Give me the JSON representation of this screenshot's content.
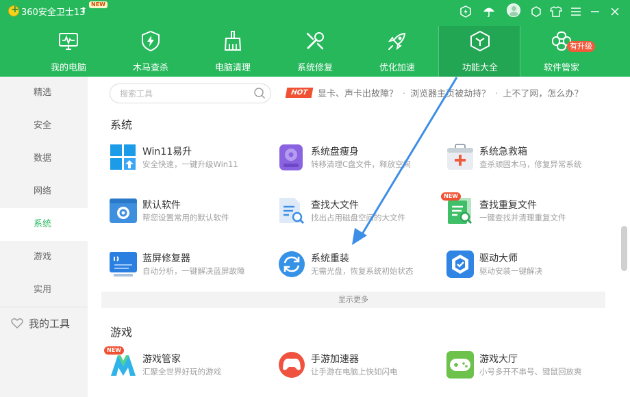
{
  "app": {
    "title": "360安全卫士13",
    "new_tag": "NEW"
  },
  "titlebar_icons": [
    "shield-badge-icon",
    "umbrella-icon",
    "avatar",
    "skin-icon",
    "shirt-icon",
    "menu-icon",
    "minimize-icon",
    "close-icon"
  ],
  "nav": [
    {
      "label": "我的电脑",
      "icon": "monitor-icon"
    },
    {
      "label": "木马查杀",
      "icon": "shield-bolt-icon"
    },
    {
      "label": "电脑清理",
      "icon": "broom-icon"
    },
    {
      "label": "系统修复",
      "icon": "wrench-icon"
    },
    {
      "label": "优化加速",
      "icon": "rocket-icon"
    },
    {
      "label": "功能大全",
      "icon": "cube-icon",
      "active": true
    },
    {
      "label": "软件管家",
      "icon": "flower-icon",
      "badge": "有升级"
    }
  ],
  "sidebar": {
    "items": [
      {
        "label": "精选"
      },
      {
        "label": "安全"
      },
      {
        "label": "数据"
      },
      {
        "label": "网络"
      },
      {
        "label": "系统",
        "active": true
      },
      {
        "label": "游戏"
      },
      {
        "label": "实用"
      }
    ],
    "my_tools": "我的工具"
  },
  "search": {
    "placeholder": "搜索工具",
    "value": ""
  },
  "hot": {
    "tag": "HOT",
    "links": [
      "显卡、声卡出故障？",
      "浏览器主页被劫持？",
      "上不了网，怎么办？"
    ],
    "separator": "·"
  },
  "sections": {
    "system": {
      "title": "系统",
      "tools": [
        {
          "name": "Win11易升",
          "desc": "安全快速，一键升级Win11",
          "icon": "windows-icon"
        },
        {
          "name": "系统盘瘦身",
          "desc": "转移清理C盘文件，释放空间",
          "icon": "disk-icon"
        },
        {
          "name": "系统急救箱",
          "desc": "查杀顽固木马，修复异常系统",
          "icon": "first-aid-icon"
        },
        {
          "name": "默认软件",
          "desc": "帮您设置常用的默认软件",
          "icon": "gear-window-icon"
        },
        {
          "name": "查找大文件",
          "desc": "找出占用磁盘空间的大文件",
          "icon": "find-file-icon"
        },
        {
          "name": "查找重复文件",
          "desc": "一键查找并清理重复文件",
          "icon": "duplicate-file-icon",
          "badge": "NEW"
        },
        {
          "name": "蓝屏修复器",
          "desc": "自动分析，一键解决蓝屏故障",
          "icon": "bluescreen-icon"
        },
        {
          "name": "系统重装",
          "desc": "无需光盘，恢复系统初始状态",
          "icon": "reinstall-icon"
        },
        {
          "name": "驱动大师",
          "desc": "驱动安装一键解决",
          "icon": "driver-icon"
        }
      ],
      "show_more": "显示更多"
    },
    "games": {
      "title": "游戏",
      "tools": [
        {
          "name": "游戏管家",
          "desc": "汇聚全世界好玩的游戏",
          "icon": "game-manager-icon",
          "badge": "NEW"
        },
        {
          "name": "手游加速器",
          "desc": "让手游在电脑上快如闪电",
          "icon": "gamepad-round-icon"
        },
        {
          "name": "游戏大厅",
          "desc": "小号多开不串号、键鼠回放爽",
          "icon": "game-hall-icon"
        }
      ]
    }
  },
  "colors": {
    "brand_green": "#27b85c",
    "active_nav": "#23a653",
    "hot_red": "#f05133",
    "arrow_blue": "#3d8ee6"
  }
}
